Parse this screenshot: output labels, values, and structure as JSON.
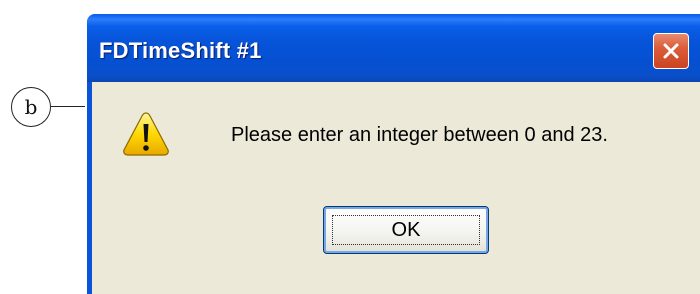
{
  "callout": {
    "label": "b"
  },
  "window": {
    "title": "FDTimeShift #1",
    "close_icon": "close-icon"
  },
  "dialog": {
    "icon": "warning-icon",
    "message": "Please enter an integer between 0 and 23.",
    "ok_label": "OK"
  },
  "colors": {
    "titlebar": "#0754D9",
    "client_bg": "#ECE9D8",
    "close_button": "#DC5D3A"
  }
}
